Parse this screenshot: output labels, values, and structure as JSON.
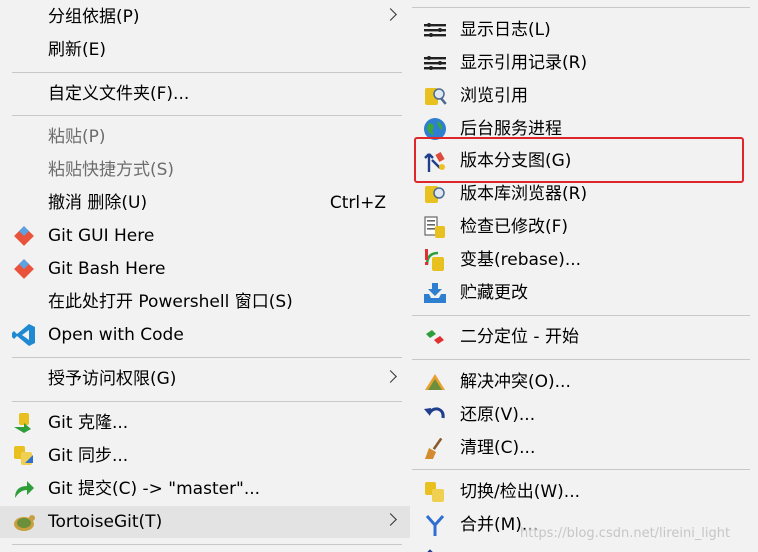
{
  "left_menu": {
    "group_by": "分组依据(P)",
    "refresh": "刷新(E)",
    "customize_folder": "自定义文件夹(F)...",
    "paste": "粘贴(P)",
    "paste_shortcut": "粘贴快捷方式(S)",
    "undo_delete": "撤消 删除(U)",
    "undo_shortcut": "Ctrl+Z",
    "git_gui": "Git GUI Here",
    "git_bash": "Git Bash Here",
    "powershell": "在此处打开 Powershell 窗口(S)",
    "open_with_code": "Open with Code",
    "grant_access": "授予访问权限(G)",
    "git_clone": "Git 克隆...",
    "git_sync": "Git 同步...",
    "git_commit": "Git 提交(C) -> \"master\"...",
    "tortoisegit": "TortoiseGit(T)"
  },
  "right_menu": {
    "show_log": "显示日志(L)",
    "show_reflog": "显示引用记录(R)",
    "browse_refs": "浏览引用",
    "daemon": "后台服务进程",
    "revision_graph": "版本分支图(G)",
    "repo_browser": "版本库浏览器(R)",
    "check_modifications": "检查已修改(F)",
    "rebase": "变基(rebase)...",
    "stash": "贮藏更改",
    "bisect": "二分定位 - 开始",
    "resolve": "解决冲突(O)...",
    "revert": "还原(V)...",
    "cleanup": "清理(C)...",
    "switch_checkout": "切换/检出(W)...",
    "merge": "合并(M)..."
  },
  "watermark": "https://blog.csdn.net/lireini_light",
  "colors": {
    "highlight_box": "#e0262a",
    "menu_bg": "#f2f2f2",
    "hover_bg": "#e3e3e3"
  }
}
